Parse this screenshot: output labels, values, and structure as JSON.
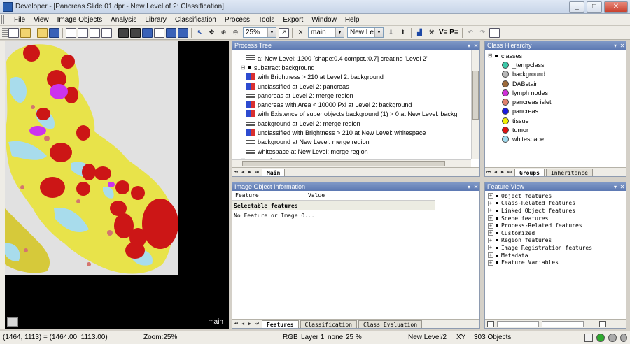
{
  "window": {
    "title": "Developer - [Pancreas Slide 01.dpr - New Level of 2: Classification]",
    "minimize": "_",
    "maximize": "□",
    "close": "✕"
  },
  "menu": [
    "File",
    "View",
    "Image Objects",
    "Analysis",
    "Library",
    "Classification",
    "Process",
    "Tools",
    "Export",
    "Window",
    "Help"
  ],
  "toolbar": {
    "zoom": "25%",
    "view_select": "main",
    "level_select": "New Leve",
    "vp_label": "V= P="
  },
  "image_view": {
    "label": "main",
    "colors": {
      "background_canvas": "#e1e1e1",
      "tissue": "#e8e34a",
      "tissue_dark": "#d6c93a",
      "whitespace": "#a8dcec",
      "tumor": "#cc1616",
      "lymph": "#cc33ee",
      "islet": "#d4756e"
    }
  },
  "process_tree": {
    "title": "Process Tree",
    "rows": [
      {
        "indent": 3,
        "icon": "create",
        "text": "a:  New Level: 1200 [shape:0.4 compct.:0.7] creating 'Level 2'"
      },
      {
        "indent": 2,
        "icon": "bullet",
        "expander": "⊟",
        "text": "subatract background"
      },
      {
        "indent": 3,
        "icon": "blue",
        "text": "with Brightness > 210  at  Level 2: background"
      },
      {
        "indent": 3,
        "icon": "blue",
        "text": "unclassified at  Level 2: pancreas"
      },
      {
        "indent": 3,
        "icon": "merge",
        "text": "pancreas at  Level 2: merge region"
      },
      {
        "indent": 3,
        "icon": "blue",
        "text": "pancreas with Area < 10000 Pxl at  Level 2: background"
      },
      {
        "indent": 3,
        "icon": "blue",
        "text": "with Existence of super objects background (1) > 0  at  New Level: backg"
      },
      {
        "indent": 3,
        "icon": "merge",
        "text": "background at  Level 2: merge region"
      },
      {
        "indent": 3,
        "icon": "blue",
        "text": "unclassified with Brightness > 210  at  New Level: whitespace"
      },
      {
        "indent": 3,
        "icon": "merge",
        "text": "background at  New Level: merge region"
      },
      {
        "indent": 3,
        "icon": "merge",
        "text": "whitespace at  New Level: merge region"
      },
      {
        "indent": 2,
        "icon": "bullet",
        "expander": "⊞",
        "text": "classify normal tissue"
      }
    ],
    "tabs": [
      "Main"
    ]
  },
  "class_hierarchy": {
    "title": "Class Hierarchy",
    "root": "classes",
    "classes": [
      {
        "name": "_tempclass",
        "color": "#3cc8a8"
      },
      {
        "name": "background",
        "color": "#b8b8b8"
      },
      {
        "name": "DABstain",
        "color": "#9c6a3a"
      },
      {
        "name": "lymph nodes",
        "color": "#d030d8"
      },
      {
        "name": "pancreas islet",
        "color": "#e0806e"
      },
      {
        "name": "pancreas",
        "color": "#1a1ae0"
      },
      {
        "name": "tissue",
        "color": "#f0f000"
      },
      {
        "name": "tumor",
        "color": "#e01010"
      },
      {
        "name": "whitespace",
        "color": "#a0dcf0"
      }
    ],
    "tabs": [
      "Groups",
      "Inheritance"
    ]
  },
  "object_info": {
    "title": "Image Object Information",
    "col_feature": "Feature",
    "col_value": "Value",
    "section": "Selectable features",
    "message": "No Feature or Image O...",
    "tabs": [
      "Features",
      "Classification",
      "Class Evaluation"
    ]
  },
  "feature_view": {
    "title": "Feature View",
    "items": [
      "Object features",
      "Class-Related features",
      "Linked Object features",
      "Scene features",
      "Process-Related features",
      "Customized",
      "Region features",
      "Image Registration features",
      "Metadata",
      "Feature Variables"
    ]
  },
  "status": {
    "coords": "(1464, 1113) = (1464.00, 1113.00)",
    "zoom": "Zoom:25%",
    "mode": "RGB",
    "layer": "Layer 1",
    "none": "none",
    "pct": "25 %",
    "level": "New Level/2",
    "xy": "XY",
    "objects": "303 Objects"
  }
}
